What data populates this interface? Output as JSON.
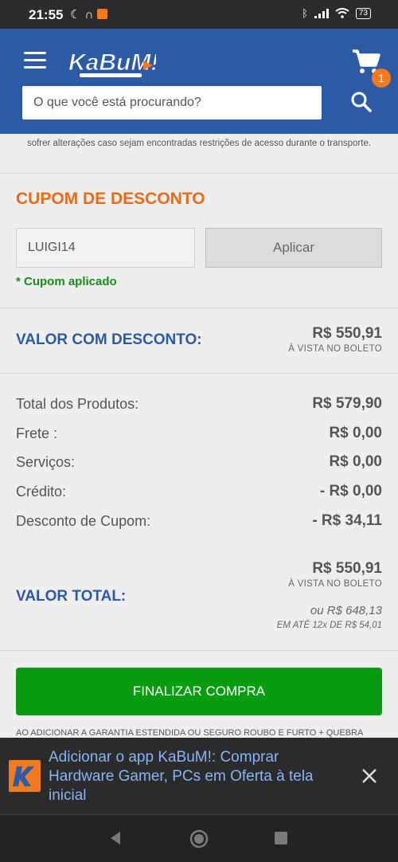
{
  "statusbar": {
    "time": "21:55",
    "battery": "73"
  },
  "header": {
    "logo_text": "KaBuM!",
    "cart_count": "1",
    "search_placeholder": "O que você está procurando?"
  },
  "notice": {
    "truncated_text": "sofrer alterações caso sejam encontradas restrições de acesso durante o transporte."
  },
  "coupon": {
    "title": "CUPOM DE DESCONTO",
    "code": "LUIGI14",
    "apply_label": "Aplicar",
    "status": "* Cupom aplicado"
  },
  "discount_value": {
    "label": "VALOR COM DESCONTO:",
    "price": "R$ 550,91",
    "note": "À VISTA NO BOLETO"
  },
  "summary": {
    "rows": [
      {
        "label": "Total dos Produtos:",
        "value": "R$ 579,90"
      },
      {
        "label": "Frete :",
        "value": "R$ 0,00"
      },
      {
        "label": "Serviços:",
        "value": "R$ 0,00"
      },
      {
        "label": "Crédito:",
        "value": "- R$ 0,00"
      },
      {
        "label": "Desconto de Cupom:",
        "value": "- R$ 34,11"
      }
    ]
  },
  "total": {
    "label": "VALOR TOTAL:",
    "price": "R$ 550,91",
    "note": "À VISTA NO BOLETO",
    "installment_price": "ou R$ 648,13",
    "installment_note": "EM ATÉ 12x DE R$ 54,01"
  },
  "finish_button": "FINALIZAR COMPRA",
  "cut_text": "AO ADICIONAR A GARANTIA ESTENDIDA OU SEGURO ROUBO E FURTO + QUEBRA",
  "app_banner": {
    "text": "Adicionar o app KaBuM!: Comprar Hardware Gamer, PCs em Oferta à tela inicial"
  },
  "colors": {
    "brand_blue": "#2c5aa5",
    "brand_orange": "#e86a1a",
    "success_green": "#1a8a1a",
    "button_green": "#089c10"
  }
}
